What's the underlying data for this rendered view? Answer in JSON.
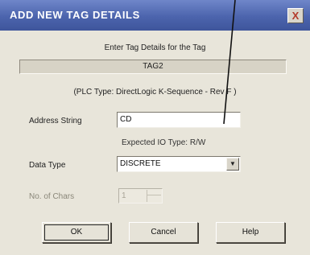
{
  "dialog": {
    "title": "ADD NEW TAG DETAILS",
    "close_glyph": "X",
    "instruction": "Enter Tag Details for the Tag",
    "tag_name": "TAG2",
    "plc_type": "(PLC Type:  DirectLogic  K-Sequence - Rev F )"
  },
  "fields": {
    "address_label": "Address String",
    "address_value": "CD",
    "expected_io": "Expected IO Type:  R/W",
    "data_type_label": "Data Type",
    "data_type_value": "DISCRETE",
    "num_chars_label": "No. of Chars",
    "num_chars_value": "1"
  },
  "buttons": {
    "ok": "OK",
    "cancel": "Cancel",
    "help": "Help"
  },
  "colors": {
    "titlebar": "#4c64ad",
    "dialog_bg": "#e8e5da"
  }
}
